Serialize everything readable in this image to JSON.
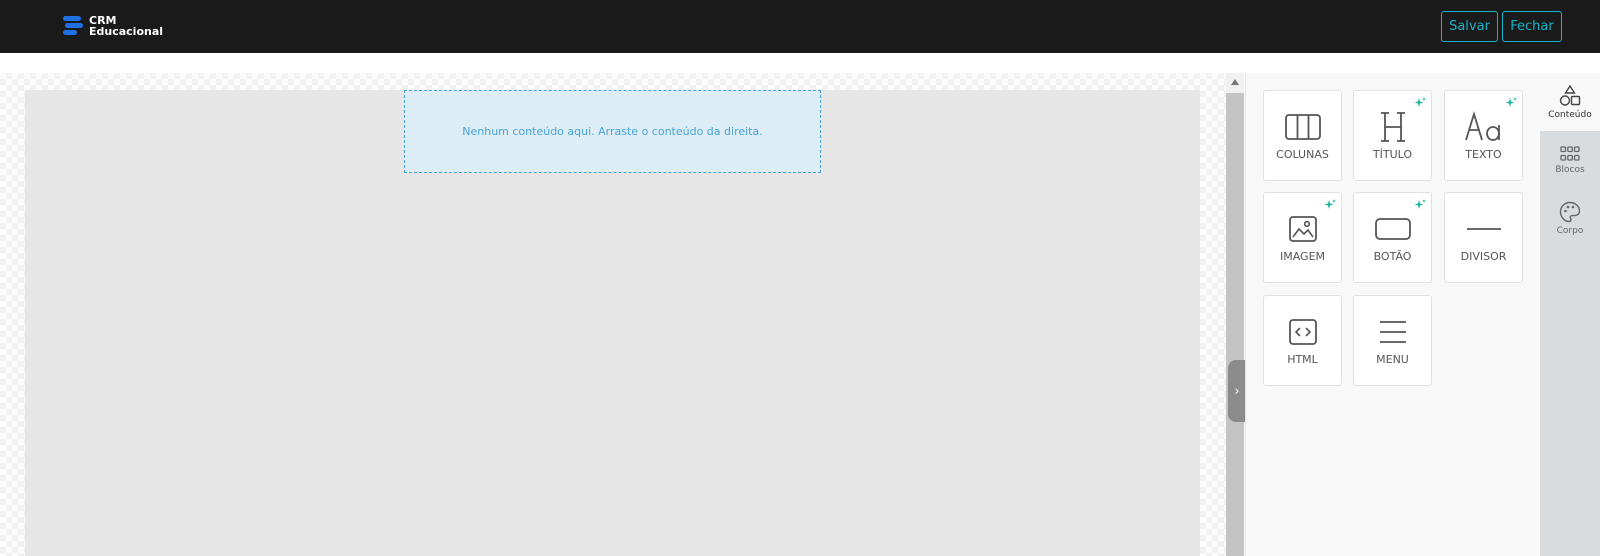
{
  "header": {
    "logo_line1": "CRM",
    "logo_line2": "Educacional",
    "save_label": "Salvar",
    "close_label": "Fechar"
  },
  "canvas": {
    "empty_message": "Nenhum conteúdo aqui. Arraste o conteúdo da direita."
  },
  "content_tools": [
    {
      "label": "COLUNAS",
      "icon": "columns-icon",
      "ai": false
    },
    {
      "label": "TÍTULO",
      "icon": "heading-icon",
      "ai": true
    },
    {
      "label": "TEXTO",
      "icon": "text-icon",
      "ai": true
    },
    {
      "label": "IMAGEM",
      "icon": "image-icon",
      "ai": true
    },
    {
      "label": "BOTÃO",
      "icon": "button-icon",
      "ai": true
    },
    {
      "label": "DIVISOR",
      "icon": "divider-icon",
      "ai": false
    },
    {
      "label": "HTML",
      "icon": "code-icon",
      "ai": false
    },
    {
      "label": "MENU",
      "icon": "menu-icon",
      "ai": false
    }
  ],
  "side_tabs": [
    {
      "label": "Conteúdo",
      "icon": "shapes-icon",
      "active": true
    },
    {
      "label": "Blocos",
      "icon": "grid-icon",
      "active": false
    },
    {
      "label": "Corpo",
      "icon": "palette-icon",
      "active": false
    }
  ],
  "colors": {
    "topbar": "#1a1a1a",
    "accent": "#17b3c9",
    "brand": "#1f6fe5",
    "dropzone_text": "#4aa3d8",
    "ai_sparkle": "#1bb39a"
  }
}
